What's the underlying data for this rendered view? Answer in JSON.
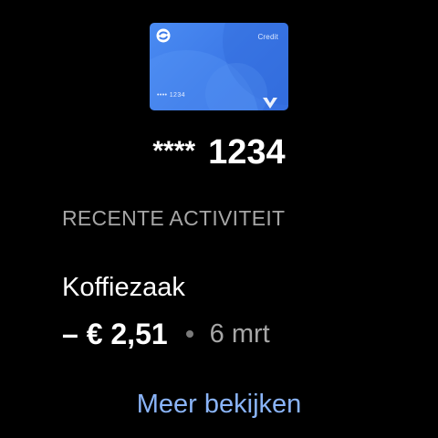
{
  "card": {
    "type_label": "Credit",
    "number_short": "•••• 1234",
    "logo_icon": "payment-app-logo-icon",
    "brand_icon": "card-brand-v-icon",
    "color": "#3d7ae8"
  },
  "account": {
    "mask": "****",
    "last_digits": "1234"
  },
  "activity": {
    "title": "RECENTE ACTIVITEIT",
    "transactions": [
      {
        "merchant": "Koffiezaak",
        "amount": "– € 2,51",
        "date": "6 mrt"
      }
    ]
  },
  "more_link": {
    "label": "Meer bekijken",
    "color": "#8ab4f8"
  }
}
